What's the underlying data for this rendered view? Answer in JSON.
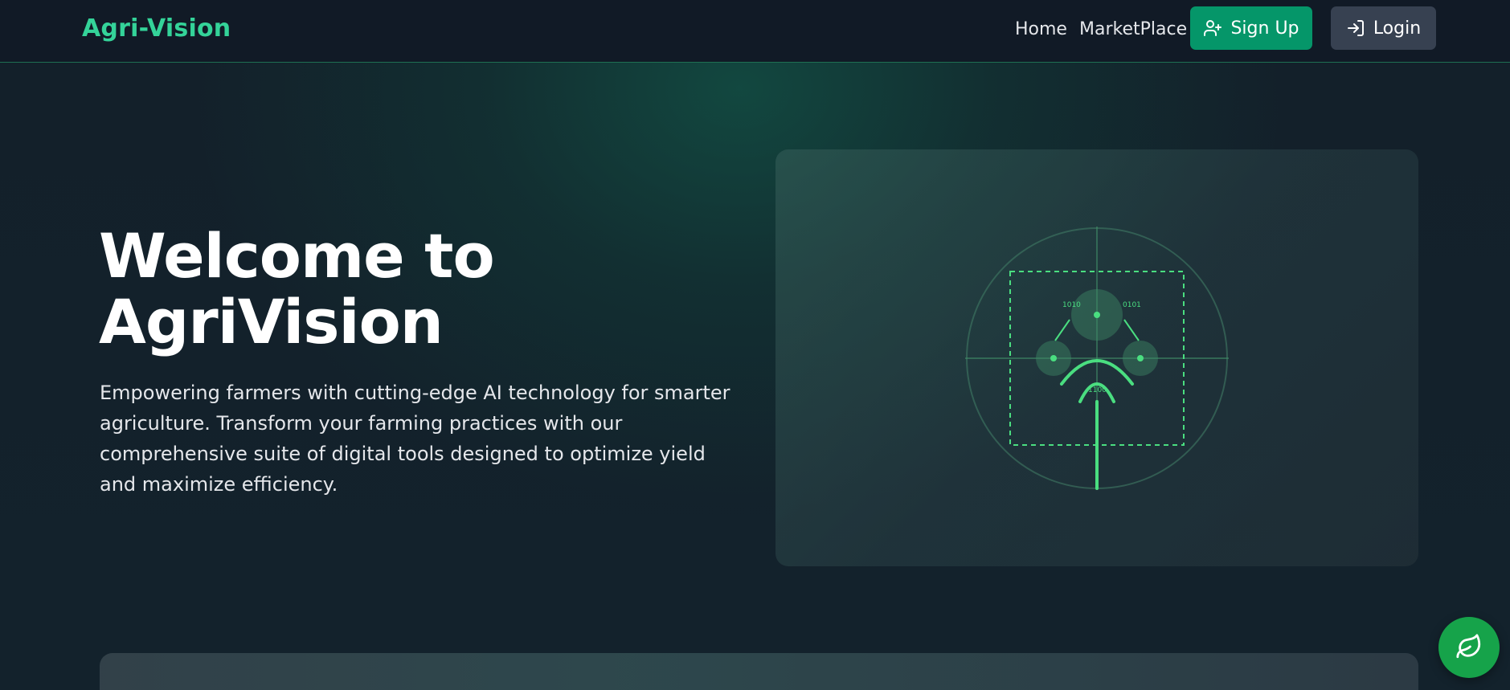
{
  "nav": {
    "brand": "Agri-Vision",
    "links": [
      {
        "label": "Home"
      },
      {
        "label": "MarketPlace"
      }
    ],
    "signup_label": "Sign Up",
    "login_label": "Login",
    "signup_icon": "user-plus-icon",
    "login_icon": "log-in-icon"
  },
  "hero": {
    "title_line1": "Welcome to",
    "title_line2": "AgriVision",
    "description": "Empowering farmers with cutting-edge AI technology for smarter agriculture. Transform your farming practices with our comprehensive suite of digital tools designed to optimize yield and maximize efficiency."
  },
  "visual": {
    "icon": "ai-plant-scanner-illustration",
    "label_left": "1010",
    "label_right": "0101",
    "label_center": "1100"
  },
  "fab": {
    "icon": "leaf-icon"
  },
  "colors": {
    "brand": "#34d399",
    "primary_button": "#059669",
    "secondary_button": "#374151",
    "accent_green": "#4ade80",
    "background": "#111827"
  }
}
